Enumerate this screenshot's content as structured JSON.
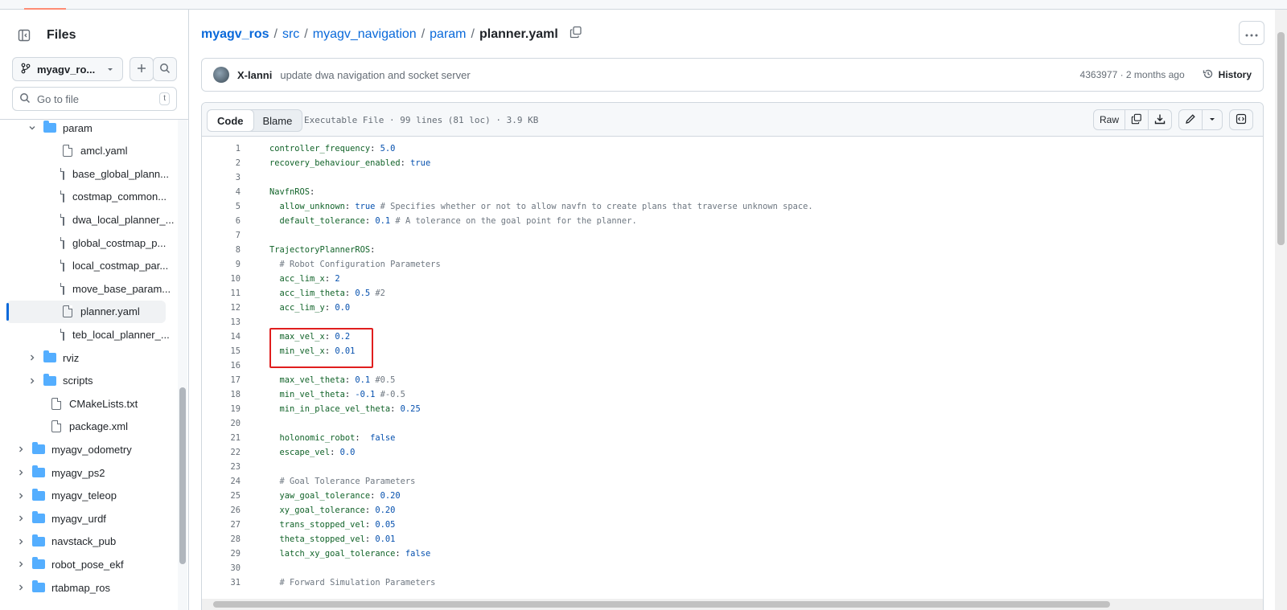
{
  "sidebar": {
    "title": "Files",
    "branch": "myagv_ro...",
    "goto_placeholder": "Go to file",
    "goto_shortcut": "t",
    "tree": [
      {
        "label": "param",
        "type": "folder",
        "expanded": true,
        "depth": 1
      },
      {
        "label": "amcl.yaml",
        "type": "file",
        "depth": 2
      },
      {
        "label": "base_global_plann...",
        "type": "file",
        "depth": 2
      },
      {
        "label": "costmap_common...",
        "type": "file",
        "depth": 2
      },
      {
        "label": "dwa_local_planner_...",
        "type": "file",
        "depth": 2
      },
      {
        "label": "global_costmap_p...",
        "type": "file",
        "depth": 2
      },
      {
        "label": "local_costmap_par...",
        "type": "file",
        "depth": 2
      },
      {
        "label": "move_base_param...",
        "type": "file",
        "depth": 2
      },
      {
        "label": "planner.yaml",
        "type": "file",
        "depth": 2,
        "selected": true
      },
      {
        "label": "teb_local_planner_...",
        "type": "file",
        "depth": 2
      },
      {
        "label": "rviz",
        "type": "folder",
        "expanded": false,
        "depth": 1
      },
      {
        "label": "scripts",
        "type": "folder",
        "expanded": false,
        "depth": 1
      },
      {
        "label": "CMakeLists.txt",
        "type": "file",
        "depth": 1
      },
      {
        "label": "package.xml",
        "type": "file",
        "depth": 1
      },
      {
        "label": "myagv_odometry",
        "type": "folder",
        "expanded": false,
        "depth": 0
      },
      {
        "label": "myagv_ps2",
        "type": "folder",
        "expanded": false,
        "depth": 0
      },
      {
        "label": "myagv_teleop",
        "type": "folder",
        "expanded": false,
        "depth": 0
      },
      {
        "label": "myagv_urdf",
        "type": "folder",
        "expanded": false,
        "depth": 0
      },
      {
        "label": "navstack_pub",
        "type": "folder",
        "expanded": false,
        "depth": 0
      },
      {
        "label": "robot_pose_ekf",
        "type": "folder",
        "expanded": false,
        "depth": 0
      },
      {
        "label": "rtabmap_ros",
        "type": "folder",
        "expanded": false,
        "depth": 0
      }
    ]
  },
  "breadcrumb": {
    "repo": "myagv_ros",
    "parts": [
      "src",
      "myagv_navigation",
      "param"
    ],
    "file": "planner.yaml"
  },
  "commit": {
    "author": "X-lanni",
    "message": "update dwa navigation and socket server",
    "meta": "4363977 · 2 months ago",
    "history_label": "History"
  },
  "file_header": {
    "tab_code": "Code",
    "tab_blame": "Blame",
    "meta": "Executable File · 99 lines (81 loc) · 3.9 KB",
    "raw_label": "Raw"
  },
  "code_lines": [
    {
      "n": "1",
      "segs": [
        [
          "k",
          "controller_frequency"
        ],
        [
          "p",
          ": "
        ],
        [
          "v",
          "5.0"
        ]
      ]
    },
    {
      "n": "2",
      "segs": [
        [
          "k",
          "recovery_behaviour_enabled"
        ],
        [
          "p",
          ": "
        ],
        [
          "v",
          "true"
        ]
      ]
    },
    {
      "n": "3",
      "segs": []
    },
    {
      "n": "4",
      "segs": [
        [
          "k",
          "NavfnROS"
        ],
        [
          "p",
          ":"
        ]
      ]
    },
    {
      "n": "5",
      "segs": [
        [
          "p",
          "  "
        ],
        [
          "k",
          "allow_unknown"
        ],
        [
          "p",
          ": "
        ],
        [
          "v",
          "true"
        ],
        [
          "c",
          " # Specifies whether or not to allow navfn to create plans that traverse unknown space."
        ]
      ]
    },
    {
      "n": "6",
      "segs": [
        [
          "p",
          "  "
        ],
        [
          "k",
          "default_tolerance"
        ],
        [
          "p",
          ": "
        ],
        [
          "v",
          "0.1"
        ],
        [
          "c",
          " # A tolerance on the goal point for the planner."
        ]
      ]
    },
    {
      "n": "7",
      "segs": []
    },
    {
      "n": "8",
      "segs": [
        [
          "k",
          "TrajectoryPlannerROS"
        ],
        [
          "p",
          ":"
        ]
      ]
    },
    {
      "n": "9",
      "segs": [
        [
          "c",
          "  # Robot Configuration Parameters"
        ]
      ]
    },
    {
      "n": "10",
      "segs": [
        [
          "p",
          "  "
        ],
        [
          "k",
          "acc_lim_x"
        ],
        [
          "p",
          ": "
        ],
        [
          "v",
          "2"
        ]
      ]
    },
    {
      "n": "11",
      "segs": [
        [
          "p",
          "  "
        ],
        [
          "k",
          "acc_lim_theta"
        ],
        [
          "p",
          ": "
        ],
        [
          "v",
          "0.5"
        ],
        [
          "c",
          " #2"
        ]
      ]
    },
    {
      "n": "12",
      "segs": [
        [
          "p",
          "  "
        ],
        [
          "k",
          "acc_lim_y"
        ],
        [
          "p",
          ": "
        ],
        [
          "v",
          "0.0"
        ]
      ]
    },
    {
      "n": "13",
      "segs": []
    },
    {
      "n": "14",
      "segs": [
        [
          "p",
          "  "
        ],
        [
          "k",
          "max_vel_x"
        ],
        [
          "p",
          ": "
        ],
        [
          "v",
          "0.2"
        ]
      ]
    },
    {
      "n": "15",
      "segs": [
        [
          "p",
          "  "
        ],
        [
          "k",
          "min_vel_x"
        ],
        [
          "p",
          ": "
        ],
        [
          "v",
          "0.01"
        ]
      ]
    },
    {
      "n": "16",
      "segs": []
    },
    {
      "n": "17",
      "segs": [
        [
          "p",
          "  "
        ],
        [
          "k",
          "max_vel_theta"
        ],
        [
          "p",
          ": "
        ],
        [
          "v",
          "0.1"
        ],
        [
          "c",
          " #0.5"
        ]
      ]
    },
    {
      "n": "18",
      "segs": [
        [
          "p",
          "  "
        ],
        [
          "k",
          "min_vel_theta"
        ],
        [
          "p",
          ": "
        ],
        [
          "v",
          "-0.1"
        ],
        [
          "c",
          " #-0.5"
        ]
      ]
    },
    {
      "n": "19",
      "segs": [
        [
          "p",
          "  "
        ],
        [
          "k",
          "min_in_place_vel_theta"
        ],
        [
          "p",
          ": "
        ],
        [
          "v",
          "0.25"
        ]
      ]
    },
    {
      "n": "20",
      "segs": []
    },
    {
      "n": "21",
      "segs": [
        [
          "p",
          "  "
        ],
        [
          "k",
          "holonomic_robot"
        ],
        [
          "p",
          ":  "
        ],
        [
          "v",
          "false"
        ]
      ]
    },
    {
      "n": "22",
      "segs": [
        [
          "p",
          "  "
        ],
        [
          "k",
          "escape_vel"
        ],
        [
          "p",
          ": "
        ],
        [
          "v",
          "0.0"
        ]
      ]
    },
    {
      "n": "23",
      "segs": []
    },
    {
      "n": "24",
      "segs": [
        [
          "c",
          "  # Goal Tolerance Parameters"
        ]
      ]
    },
    {
      "n": "25",
      "segs": [
        [
          "p",
          "  "
        ],
        [
          "k",
          "yaw_goal_tolerance"
        ],
        [
          "p",
          ": "
        ],
        [
          "v",
          "0.20"
        ]
      ]
    },
    {
      "n": "26",
      "segs": [
        [
          "p",
          "  "
        ],
        [
          "k",
          "xy_goal_tolerance"
        ],
        [
          "p",
          ": "
        ],
        [
          "v",
          "0.20"
        ]
      ]
    },
    {
      "n": "27",
      "segs": [
        [
          "p",
          "  "
        ],
        [
          "k",
          "trans_stopped_vel"
        ],
        [
          "p",
          ": "
        ],
        [
          "v",
          "0.05"
        ]
      ]
    },
    {
      "n": "28",
      "segs": [
        [
          "p",
          "  "
        ],
        [
          "k",
          "theta_stopped_vel"
        ],
        [
          "p",
          ": "
        ],
        [
          "v",
          "0.01"
        ]
      ]
    },
    {
      "n": "29",
      "segs": [
        [
          "p",
          "  "
        ],
        [
          "k",
          "latch_xy_goal_tolerance"
        ],
        [
          "p",
          ": "
        ],
        [
          "v",
          "false"
        ]
      ]
    },
    {
      "n": "30",
      "segs": []
    },
    {
      "n": "31",
      "segs": [
        [
          "c",
          "  # Forward Simulation Parameters"
        ]
      ]
    }
  ],
  "colors": {
    "link": "#0969da",
    "folder": "#54aeff",
    "highlight": "#e01e1e"
  }
}
